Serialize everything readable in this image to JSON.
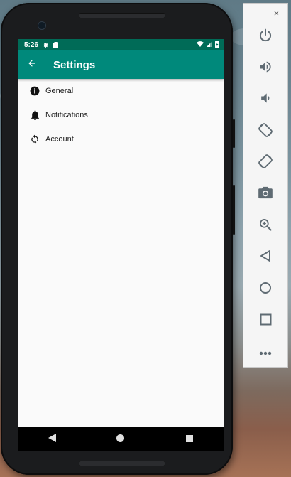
{
  "status_bar": {
    "time": "5:26",
    "left_icons": [
      "gear-icon",
      "sd-card-icon"
    ],
    "right_icons": [
      "wifi-icon",
      "signal-icon",
      "battery-icon"
    ]
  },
  "app_bar": {
    "title": "Settings",
    "back_icon": "arrow-back-icon"
  },
  "settings_items": [
    {
      "label": "General",
      "icon": "info-icon"
    },
    {
      "label": "Notifications",
      "icon": "bell-icon"
    },
    {
      "label": "Account",
      "icon": "sync-icon"
    }
  ],
  "nav_bar": [
    "back-triangle-icon",
    "home-circle-icon",
    "recents-square-icon"
  ],
  "emulator_panel": {
    "window_controls": [
      "–",
      "×"
    ],
    "tools": [
      "power",
      "volume-up",
      "volume-down",
      "rotate-left",
      "rotate-right",
      "screenshot",
      "zoom",
      "back",
      "home",
      "overview",
      "more"
    ]
  },
  "colors": {
    "status_bar": "#006b57",
    "app_bar": "#00897b",
    "screen_bg": "#fafafa",
    "nav_bar": "#000000"
  }
}
